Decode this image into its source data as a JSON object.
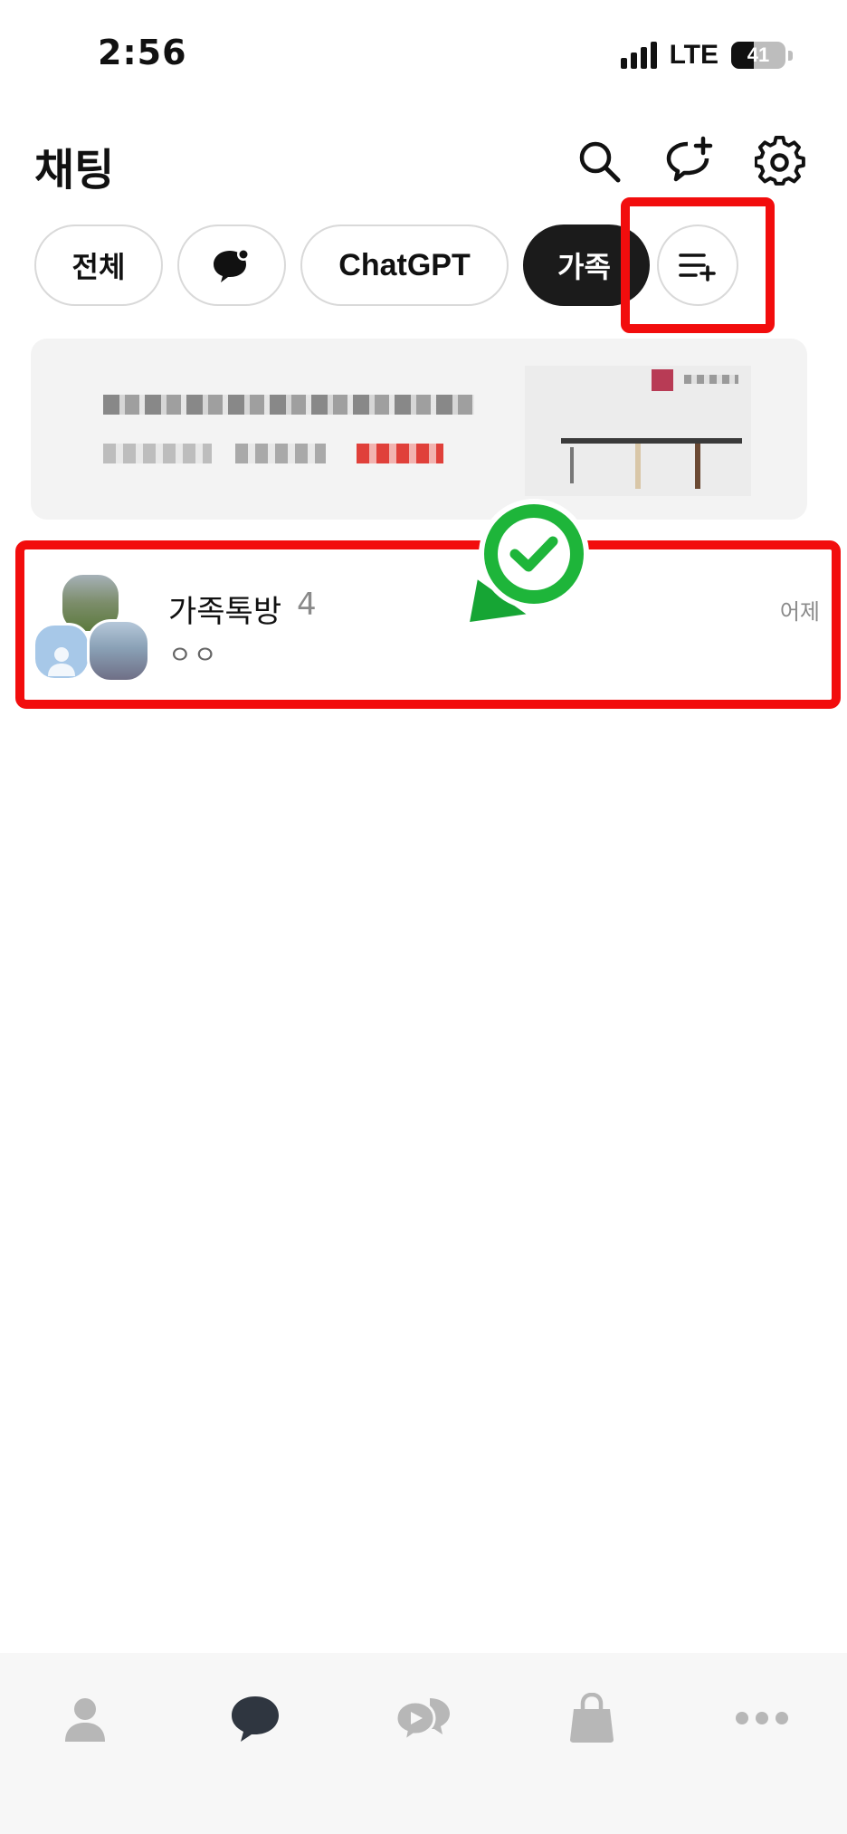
{
  "status_bar": {
    "time": "2:56",
    "network": "LTE",
    "battery": "41",
    "battery_level": 0.41
  },
  "header": {
    "title": "채팅",
    "icons": [
      "search-icon",
      "new-chat-icon",
      "settings-icon"
    ]
  },
  "filters": {
    "chips": [
      {
        "label": "전체",
        "selected": false
      },
      {
        "icon": "openchat-icon",
        "selected": false
      },
      {
        "label": "ChatGPT",
        "selected": false
      },
      {
        "label": "가족",
        "selected": true
      }
    ],
    "add_icon": "add-folder-icon"
  },
  "chats": [
    {
      "name": "가족톡방",
      "member_count": "4",
      "preview": "ㅇㅇ",
      "time": "어제"
    }
  ],
  "tab_bar": {
    "items": [
      "friends-icon",
      "chats-icon",
      "openchat-icon",
      "shopping-icon",
      "more-icon"
    ],
    "active": "chats-icon"
  },
  "colors": {
    "highlight": "#f20d0d",
    "check_badge": "#1eb53a",
    "selected_chip": "#1b1b1b",
    "tab_active": "#2f3640",
    "tab_inactive": "#b7b7b7"
  }
}
